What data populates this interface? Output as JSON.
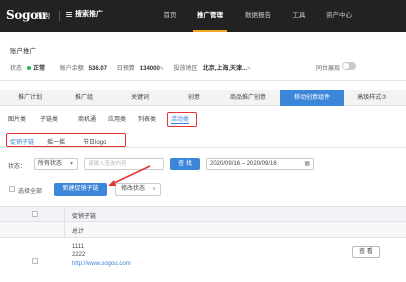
{
  "nav": {
    "logo": "Sogou",
    "logo_sub": "搜狗",
    "menu_label": "搜索推广",
    "items": [
      "首页",
      "推广管理",
      "数据报告",
      "工具",
      "资产中心"
    ],
    "active": "推广管理"
  },
  "account": {
    "title": "账户推广",
    "status_label": "状态",
    "status_value": "正常",
    "balance_label": "账户余额",
    "balance_value": "536.07",
    "budget_label": "日预算",
    "budget_value": "134000",
    "region_label": "投放地区",
    "region_value": "北京,上海,天津...",
    "switch_label": "同台展现"
  },
  "main_tabs": [
    "推广计划",
    "推广组",
    "关键词",
    "创意",
    "商品推广创意",
    "移动创意组件",
    "高级样式⑦"
  ],
  "main_tab_active": "移动创意组件",
  "sub_tabs": [
    "图片类",
    "子链类",
    "商机通",
    "应用类",
    "列表类",
    "活动类"
  ],
  "sub_tab_active": "活动类",
  "third_tabs": [
    "促销子链",
    "摇一摇",
    "节日logo"
  ],
  "third_tab_active": "促销子链",
  "filter": {
    "status_label": "状态：",
    "status_value": "所有状态",
    "search_placeholder": "请输入查询内容",
    "search_button": "查 找",
    "date_range": "2020/09/16 – 2020/09/16"
  },
  "actions": {
    "select_all": "选择全部",
    "new_button": "新建促销子链",
    "status_button": "修改状态"
  },
  "table": {
    "header": "促销子链",
    "total_label": "总计",
    "rows": [
      {
        "line1": "1111",
        "line2": "2222",
        "url": "http://www.sogou.com",
        "view_button": "查 看"
      }
    ]
  },
  "colors": {
    "accent": "#3b86d8",
    "highlight": "#e63333",
    "nav_bg": "#222222"
  }
}
